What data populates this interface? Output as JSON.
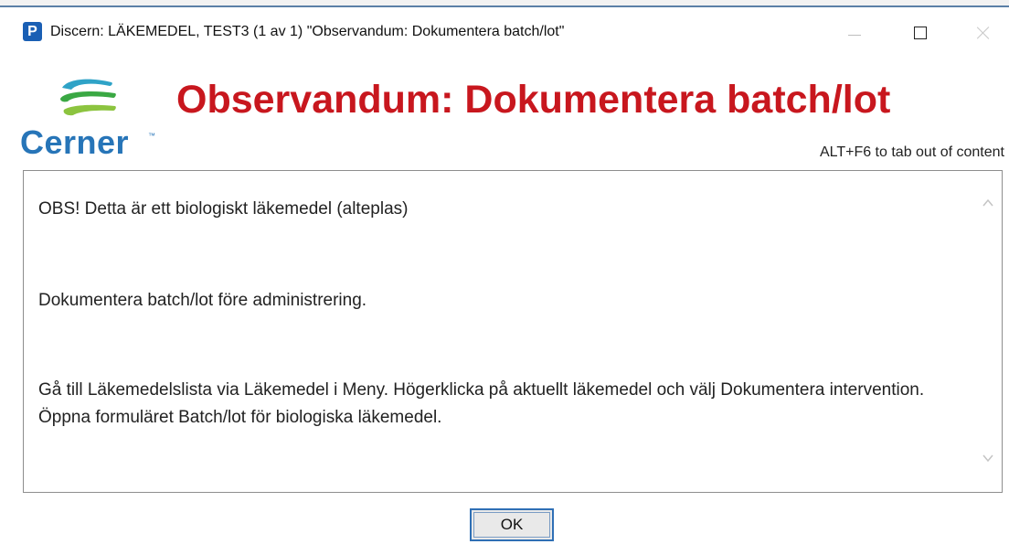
{
  "window": {
    "icon_letter": "P",
    "title": "Discern: LÄKEMEDEL, TEST3 (1 av 1) \"Observandum: Dokumentera batch/lot\""
  },
  "logo": {
    "text": "Cerner",
    "tm": "™",
    "colors": {
      "top_stripe": "#2fa3c7",
      "middle_stripe": "#3aa843",
      "bottom_stripe": "#8cc43f",
      "text": "#2775b8"
    }
  },
  "header": {
    "title": "Observandum: Dokumentera batch/lot",
    "title_color": "#c8171e",
    "hint": "ALT+F6 to tab out of content"
  },
  "content": {
    "paragraphs": [
      "OBS! Detta är ett biologiskt läkemedel (alteplas)",
      "Dokumentera batch/lot före administrering.",
      "Gå till Läkemedelslista via Läkemedel i Meny. Högerklicka på aktuellt läkemedel och välj Dokumentera intervention. Öppna formuläret Batch/lot för biologiska läkemedel."
    ]
  },
  "buttons": {
    "ok_label": "OK"
  },
  "icons": {
    "app": "app-icon",
    "minimize": "minimize-icon",
    "maximize": "maximize-icon",
    "close": "close-icon",
    "scroll_up": "chevron-up-icon",
    "scroll_down": "chevron-down-icon"
  }
}
